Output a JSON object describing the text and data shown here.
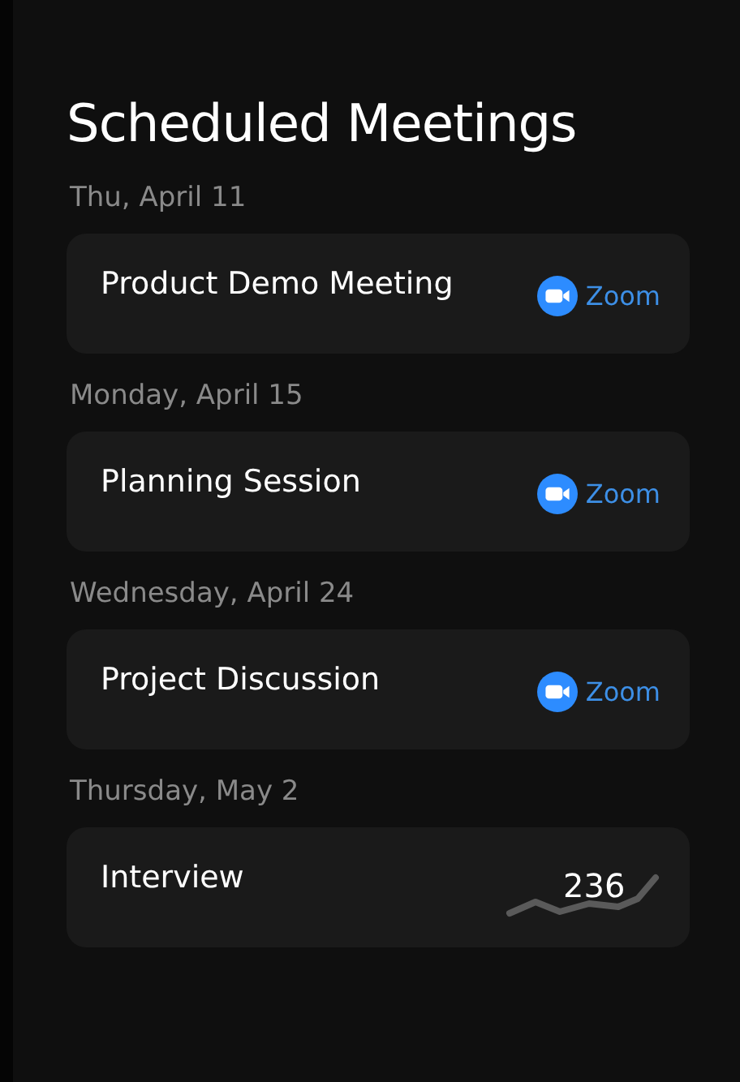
{
  "title": "Scheduled Meetings",
  "meetings": [
    {
      "date": "Thu, April 11",
      "title": "Product Demo Meeting",
      "kind": "zoom",
      "link": "Zoom"
    },
    {
      "date": "Monday, April 15",
      "title": "Planning Session",
      "kind": "zoom",
      "link": "Zoom"
    },
    {
      "date": "Wednesday, April 24",
      "title": "Project Discussion",
      "kind": "zoom",
      "link": "Zoom"
    },
    {
      "date": "Thursday, May 2",
      "title": "Interview",
      "kind": "trend",
      "value": "236"
    }
  ]
}
